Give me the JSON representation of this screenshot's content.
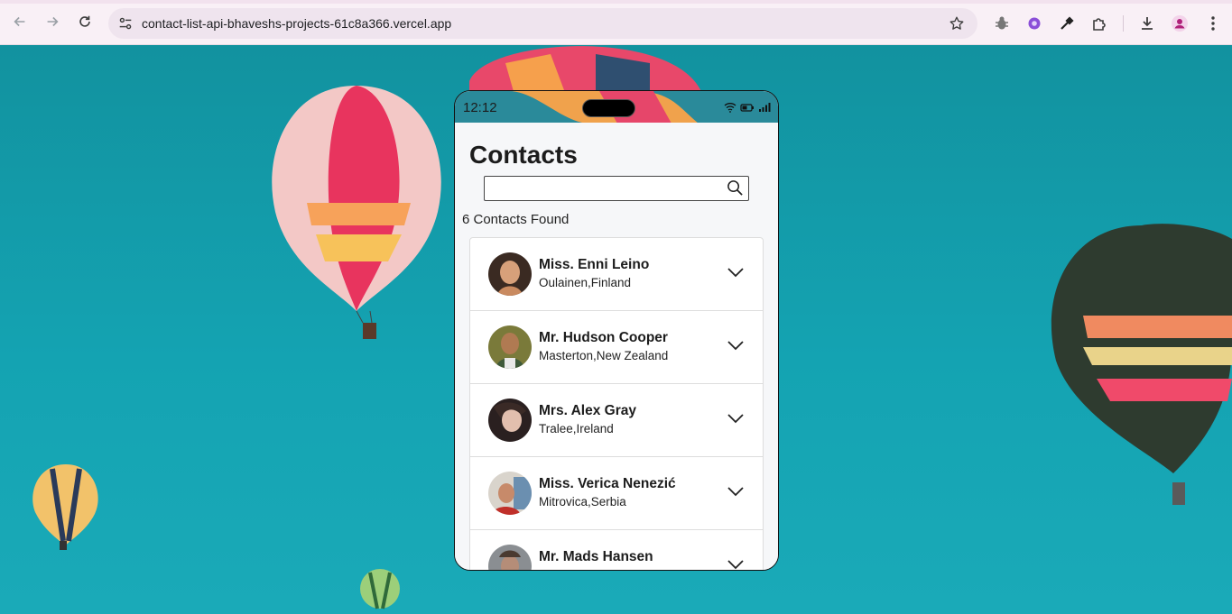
{
  "browser": {
    "url": "contact-list-api-bhaveshs-projects-61c8a366.vercel.app",
    "accent": "#f9f0f6"
  },
  "phone": {
    "time": "12:12"
  },
  "app": {
    "title": "Contacts",
    "search": {
      "placeholder": "",
      "value": ""
    },
    "count_text": "6 Contacts Found",
    "contacts": [
      {
        "name": "Miss. Enni Leino",
        "location": "Oulainen,Finland",
        "avatar_color": "#7a4a3a"
      },
      {
        "name": "Mr. Hudson Cooper",
        "location": "Masterton,New Zealand",
        "avatar_color": "#4e6b3a"
      },
      {
        "name": "Mrs. Alex Gray",
        "location": "Tralee,Ireland",
        "avatar_color": "#5a4440"
      },
      {
        "name": "Miss. Verica Nenezić",
        "location": "Mitrovica,Serbia",
        "avatar_color": "#a0483a"
      },
      {
        "name": "Mr. Mads Hansen",
        "location": "",
        "avatar_color": "#6c6f73"
      }
    ]
  }
}
